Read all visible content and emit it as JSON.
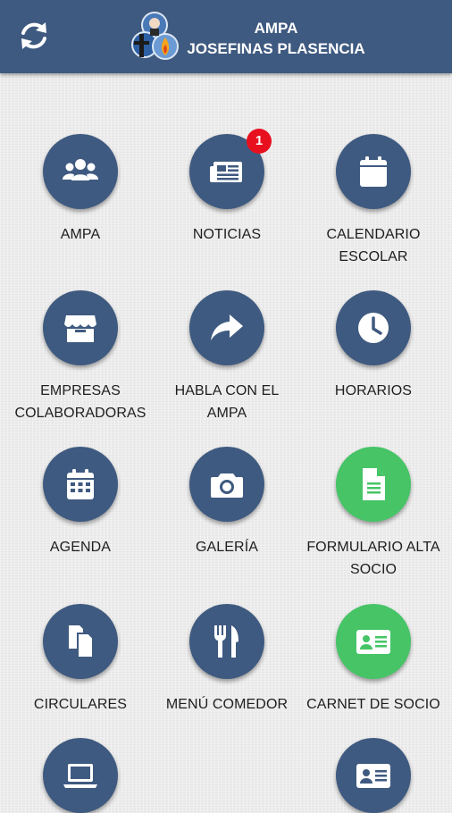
{
  "header": {
    "title_line1": "AMPA",
    "title_line2": "JOSEFINAS PLASENCIA",
    "refresh_icon": "refresh-icon",
    "logo": "josefinas-plasencia-logo",
    "background_color": "#3f5a80"
  },
  "colors": {
    "tile_blue": "#3f5a80",
    "tile_green": "#46c466",
    "badge_red": "#e8101f"
  },
  "menu": {
    "items": [
      {
        "line1": "AMPA",
        "line2": "",
        "icon": "users-icon"
      },
      {
        "line1": "NOTICIAS",
        "line2": "",
        "icon": "newspaper-icon",
        "badge": "1"
      },
      {
        "line1": "CALENDARIO",
        "line2": "ESCOLAR",
        "icon": "calendar-icon"
      },
      {
        "line1": "EMPRESAS",
        "line2": "COLABORADORAS",
        "icon": "store-icon"
      },
      {
        "line1": "HABLA CON EL",
        "line2": "AMPA",
        "icon": "share-arrow-icon"
      },
      {
        "line1": "HORARIOS",
        "line2": "",
        "icon": "clock-icon"
      },
      {
        "line1": "AGENDA",
        "line2": "",
        "icon": "calendar-grid-icon"
      },
      {
        "line1": "GALERÍA",
        "line2": "",
        "icon": "camera-icon"
      },
      {
        "line1": "FORMULARIO ALTA",
        "line2": "SOCIO",
        "icon": "document-icon"
      },
      {
        "line1": "CIRCULARES",
        "line2": "",
        "icon": "copy-documents-icon"
      },
      {
        "line1": "MENÚ COMEDOR",
        "line2": "",
        "icon": "cutlery-icon"
      },
      {
        "line1": "CARNET DE SOCIO",
        "line2": "",
        "icon": "id-card-icon"
      },
      {
        "line1": "",
        "line2": "",
        "icon": "laptop-icon"
      },
      {
        "line1": "",
        "line2": "",
        "icon": "id-card-icon"
      }
    ]
  }
}
